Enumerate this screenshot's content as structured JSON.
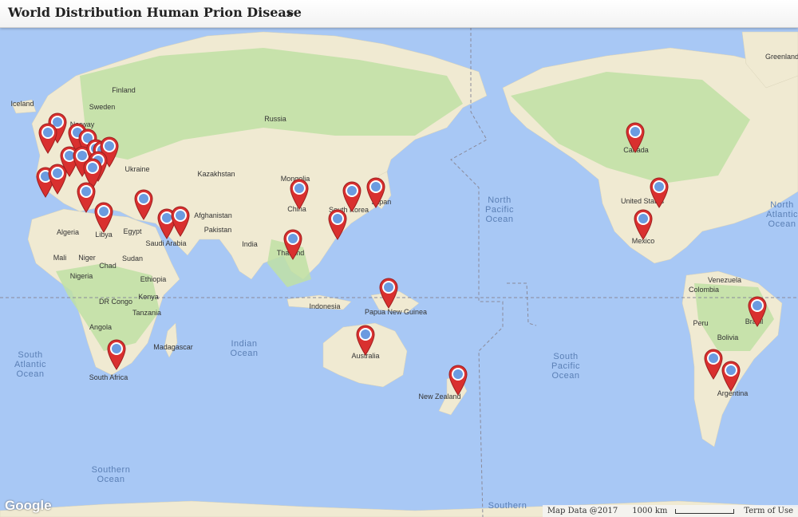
{
  "title": "World Distribution Human Prion Disease",
  "title_arrow": "➤",
  "colors": {
    "ocean": "#a8c8f5",
    "land": "#f0ead2",
    "vegetation": "#bfe0a4",
    "pin": "#d9302f",
    "pin_dot": "#6b9be0"
  },
  "labels": {
    "iceland": "Iceland",
    "norway": "Norway",
    "finland": "Finland",
    "sweden": "Sweden",
    "russia": "Russia",
    "ukraine": "Ukraine",
    "kazakhstan": "Kazakhstan",
    "mongolia": "Mongolia",
    "china": "China",
    "afghanistan": "Afghanistan",
    "pakistan": "Pakistan",
    "south_korea": "South Korea",
    "japan": "Japan",
    "thailand": "Thailand",
    "india": "India",
    "algeria": "Algeria",
    "libya": "Libya",
    "egypt": "Egypt",
    "saudi_arabia": "Saudi Arabia",
    "mali": "Mali",
    "niger": "Niger",
    "chad": "Chad",
    "sudan": "Sudan",
    "nigeria": "Nigeria",
    "ethiopia": "Ethiopia",
    "dr_congo": "DR Congo",
    "kenya": "Kenya",
    "tanzania": "Tanzania",
    "angola": "Angola",
    "madagascar": "Madagascar",
    "south_africa": "South Africa",
    "indonesia": "Indonesia",
    "papua_new_guinea": "Papua New Guinea",
    "australia": "Australia",
    "new_zealand": "New Zealand",
    "canada": "Canada",
    "united_states": "United States",
    "mexico": "Mexico",
    "venezuela": "Venezuela",
    "colombia": "Colombia",
    "peru": "Peru",
    "brazil": "Brazil",
    "bolivia": "Bolivia",
    "argentina": "Argentina",
    "greenland": "Greenland"
  },
  "oceans": {
    "north_pacific": "North Pacific Ocean",
    "south_pacific": "South Pacific Ocean",
    "north_atlantic": "North Atlantic Ocean",
    "south_atlantic": "South Atlantic Ocean",
    "indian": "Indian Ocean",
    "southern_1": "Southern Ocean",
    "southern_2": "Southern"
  },
  "footer": {
    "google": "Google",
    "map_data": "Map Data @2017",
    "scale": "1000 km",
    "terms": "Term of Use"
  }
}
